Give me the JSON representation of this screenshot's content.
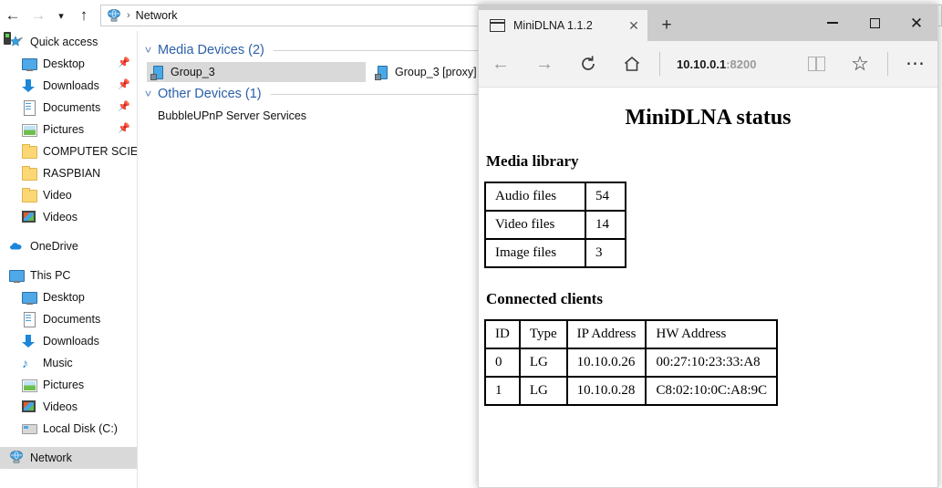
{
  "explorer": {
    "nav": {
      "back_icon": "arrow-left-icon",
      "forward_icon": "arrow-right-icon",
      "recent_icon": "chevron-down-icon",
      "up_icon": "arrow-up-icon"
    },
    "address": {
      "icon": "network-icon",
      "separator": "›",
      "path": "Network"
    },
    "sidebar": {
      "sections": [
        {
          "name": "quick-access",
          "header": {
            "label": "Quick access",
            "icon": "star-pin-icon"
          },
          "items": [
            {
              "label": "Desktop",
              "icon": "monitor-icon",
              "pinned": true
            },
            {
              "label": "Downloads",
              "icon": "download-icon",
              "pinned": true
            },
            {
              "label": "Documents",
              "icon": "document-icon",
              "pinned": true
            },
            {
              "label": "Pictures",
              "icon": "picture-icon",
              "pinned": true
            },
            {
              "label": "COMPUTER SCIENCE",
              "icon": "folder-icon",
              "pinned": false
            },
            {
              "label": "RASPBIAN",
              "icon": "folder-icon",
              "pinned": false
            },
            {
              "label": "Video",
              "icon": "folder-icon",
              "pinned": false
            },
            {
              "label": "Videos",
              "icon": "videos-icon",
              "pinned": false
            }
          ]
        },
        {
          "name": "onedrive",
          "header": {
            "label": "OneDrive",
            "icon": "cloud-icon"
          },
          "items": []
        },
        {
          "name": "this-pc",
          "header": {
            "label": "This PC",
            "icon": "monitor-icon"
          },
          "items": [
            {
              "label": "Desktop",
              "icon": "monitor-icon",
              "pinned": false
            },
            {
              "label": "Documents",
              "icon": "document-icon",
              "pinned": false
            },
            {
              "label": "Downloads",
              "icon": "download-icon",
              "pinned": false
            },
            {
              "label": "Music",
              "icon": "music-note-icon",
              "pinned": false
            },
            {
              "label": "Pictures",
              "icon": "picture-icon",
              "pinned": false
            },
            {
              "label": "Videos",
              "icon": "videos-icon",
              "pinned": false
            },
            {
              "label": "Local Disk (C:)",
              "icon": "disk-icon",
              "pinned": false
            }
          ]
        },
        {
          "name": "network",
          "header": {
            "label": "Network",
            "icon": "network-icon",
            "selected": true
          },
          "items": []
        }
      ]
    },
    "content": {
      "groups": [
        {
          "name": "media-devices",
          "title": "Media Devices (2)",
          "chevron": "chevron-down-icon",
          "items": [
            {
              "label": "Group_3",
              "icon": "media-device-icon",
              "selected": true
            },
            {
              "label": "Group_3 [proxy]",
              "icon": "media-device-icon",
              "selected": false
            }
          ]
        },
        {
          "name": "other-devices",
          "title": "Other Devices (1)",
          "chevron": "chevron-down-icon",
          "items": [
            {
              "label": "BubbleUPnP Server Services",
              "icon": "other-device-icon",
              "selected": false
            }
          ]
        }
      ]
    }
  },
  "browser": {
    "tab": {
      "title": "MiniDLNA 1.1.2",
      "favicon": "window-icon",
      "close_icon": "close-icon"
    },
    "newtab_label": "+",
    "window_controls": {
      "minimize": "minimize-icon",
      "maximize": "maximize-icon",
      "close": "close-icon"
    },
    "toolbar": {
      "back_icon": "arrow-left-icon",
      "forward_icon": "arrow-right-icon",
      "refresh_icon": "refresh-icon",
      "home_icon": "home-icon",
      "url_host": "10.10.0.1",
      "url_port": ":8200",
      "reading_list_icon": "book-icon",
      "favorite_icon": "star-icon",
      "more_icon": "ellipsis-icon"
    },
    "page": {
      "title": "MiniDLNA status",
      "media_library": {
        "heading": "Media library",
        "rows": [
          {
            "label": "Audio files",
            "value": "54"
          },
          {
            "label": "Video files",
            "value": "14"
          },
          {
            "label": "Image files",
            "value": "3"
          }
        ]
      },
      "connected_clients": {
        "heading": "Connected clients",
        "columns": [
          "ID",
          "Type",
          "IP Address",
          "HW Address"
        ],
        "rows": [
          [
            "0",
            "LG",
            "10.10.0.26",
            "00:27:10:23:33:A8"
          ],
          [
            "1",
            "LG",
            "10.10.0.28",
            "C8:02:10:0C:A8:9C"
          ]
        ]
      }
    }
  },
  "colors": {
    "explorer_selection": "#d9d9d9",
    "group_header_blue": "#2a5fa8",
    "titlebar_gray": "#cccccc",
    "toolbar_gray": "#f2f2f2",
    "accent_blue": "#1c86d8"
  }
}
